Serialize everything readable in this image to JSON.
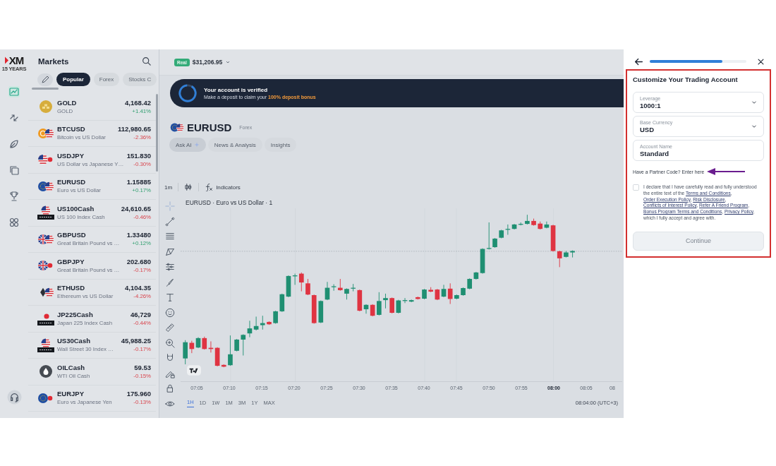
{
  "brand": {
    "logo": "XM",
    "tagline": "15 YEARS"
  },
  "nav_rail": [
    {
      "selected": true
    },
    {
      "selected": false
    },
    {
      "selected": false
    },
    {
      "selected": false
    },
    {
      "selected": false
    },
    {
      "selected": false
    }
  ],
  "markets": {
    "title": "Markets",
    "tabs": [
      {
        "label": "Popular",
        "selected": true
      },
      {
        "label": "Forex",
        "selected": false
      },
      {
        "label": "Stocks C",
        "selected": false
      }
    ],
    "rows": [
      {
        "symbol": "GOLD",
        "name": "GOLD",
        "price": "4,168.42",
        "change": "+1.41%",
        "rising": true
      },
      {
        "symbol": "BTCUSD",
        "name": "Bitcoin vs US Dollar",
        "price": "112,980.65",
        "change": "-2.36%",
        "rising": false
      },
      {
        "symbol": "USDJPY",
        "name": "US Dollar vs Japanese Y…",
        "price": "151.830",
        "change": "-0.30%",
        "rising": false
      },
      {
        "symbol": "EURUSD",
        "name": "Euro vs US Dollar",
        "price": "1.15885",
        "change": "+0.17%",
        "rising": true
      },
      {
        "symbol": "US100Cash",
        "name": "US 100 Index Cash",
        "price": "24,610.65",
        "change": "-0.46%",
        "rising": false
      },
      {
        "symbol": "GBPUSD",
        "name": "Great Britain Pound vs …",
        "price": "1.33480",
        "change": "+0.12%",
        "rising": true
      },
      {
        "symbol": "GBPJPY",
        "name": "Great Britain Pound vs …",
        "price": "202.680",
        "change": "-0.17%",
        "rising": false
      },
      {
        "symbol": "ETHUSD",
        "name": "Ethereum vs US Dollar",
        "price": "4,104.35",
        "change": "-4.26%",
        "rising": false
      },
      {
        "symbol": "JP225Cash",
        "name": "Japan 225 Index Cash",
        "price": "46,729",
        "change": "-0.44%",
        "rising": false
      },
      {
        "symbol": "US30Cash",
        "name": "Wall Street 30 Index …",
        "price": "45,988.25",
        "change": "-0.17%",
        "rising": false
      },
      {
        "symbol": "OILCash",
        "name": "WTI Oil Cash",
        "price": "59.53",
        "change": "-0.15%",
        "rising": false
      },
      {
        "symbol": "EURJPY",
        "name": "Euro vs Japanese Yen",
        "price": "175.960",
        "change": "-0.13%",
        "rising": false
      }
    ]
  },
  "account": {
    "badge": "Real",
    "balance": "$31,206.95"
  },
  "banner": {
    "title": "Your account is verified",
    "message": "Make a deposit to claim your **100% deposit bonus**"
  },
  "instrument": {
    "symbol": "EURUSD",
    "category": "Forex",
    "tabs": [
      {
        "label": "Ask AI",
        "selected": true
      },
      {
        "label": "News & Analysis",
        "selected": false
      },
      {
        "label": "Insights",
        "selected": false
      }
    ]
  },
  "chart_toolbar": {
    "interval": "1m",
    "indicators": "Indicators"
  },
  "chart": {
    "title": "EURUSD · Euro vs US Dollar · 1",
    "x_labels": [
      {
        "label": "07:05",
        "current": false
      },
      {
        "label": "07:10",
        "current": false
      },
      {
        "label": "07:15",
        "current": false
      },
      {
        "label": "07:20",
        "current": false
      },
      {
        "label": "07:25",
        "current": false
      },
      {
        "label": "07:30",
        "current": false
      },
      {
        "label": "07:35",
        "current": false
      },
      {
        "label": "07:40",
        "current": false
      },
      {
        "label": "07:45",
        "current": false
      },
      {
        "label": "07:50",
        "current": false
      },
      {
        "label": "07:55",
        "current": false
      },
      {
        "label": "08:00",
        "current": true
      },
      {
        "label": "08:05",
        "current": false
      },
      {
        "label": "08",
        "current": false
      }
    ],
    "ranges": [
      {
        "label": "1H",
        "selected": true
      },
      {
        "label": "1D",
        "selected": false
      },
      {
        "label": "1W",
        "selected": false
      },
      {
        "label": "1M",
        "selected": false
      },
      {
        "label": "3M",
        "selected": false
      },
      {
        "label": "1Y",
        "selected": false
      },
      {
        "label": "MAX",
        "selected": false
      }
    ],
    "clock": "08:04:00 (UTC+3)"
  },
  "setup_panel": {
    "progress": {
      "level": 0.75
    },
    "title": "Customize Your Trading Account",
    "fields": [
      {
        "label": "Leverage",
        "value": "1000:1",
        "kind": "select"
      },
      {
        "label": "Base Currency",
        "value": "USD",
        "kind": "select"
      },
      {
        "label": "Account Name",
        "value": "Standard",
        "kind": "text"
      }
    ],
    "partner_code": {
      "prompt": "Have a Partner Code?",
      "link": "Enter here"
    },
    "declaration": {
      "checked": false,
      "parts": [
        {
          "kind": "text",
          "text": "I declare that I have carefully read and fully understood the entire text of the "
        },
        {
          "kind": "link",
          "text": "Terms and Conditions"
        },
        {
          "kind": "text",
          "text": ", "
        },
        {
          "kind": "link",
          "text": "Order Execution Policy"
        },
        {
          "kind": "text",
          "text": ", "
        },
        {
          "kind": "link",
          "text": "Risk Disclosure"
        },
        {
          "kind": "text",
          "text": ", "
        },
        {
          "kind": "link",
          "text": "Conflicts of Interest Policy"
        },
        {
          "kind": "text",
          "text": ", "
        },
        {
          "kind": "link",
          "text": "Refer A Friend Program"
        },
        {
          "kind": "text",
          "text": ", "
        },
        {
          "kind": "link",
          "text": "Bonus Program Terms and Conditions"
        },
        {
          "kind": "text",
          "text": ", "
        },
        {
          "kind": "link",
          "text": "Privacy Policy"
        },
        {
          "kind": "text",
          "text": ", which I fully accept and agree with."
        }
      ]
    },
    "continue_button": {
      "label": "Continue",
      "disabled": true
    }
  }
}
